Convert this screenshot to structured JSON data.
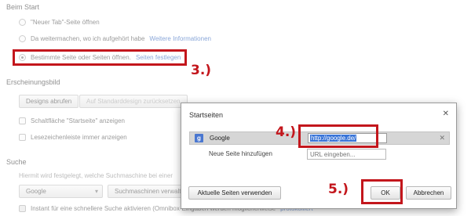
{
  "settings": {
    "startup": {
      "title": "Beim Start",
      "options": [
        {
          "label": "\"Neuer Tab\"-Seite öffnen",
          "link": ""
        },
        {
          "label": "Da weitermachen, wo ich aufgehört habe",
          "link": "Weitere Informationen"
        },
        {
          "label": "Bestimmte Seite oder Seiten öffnen.",
          "link": "Seiten festlegen"
        }
      ],
      "selected_index": 2
    },
    "appearance": {
      "title": "Erscheinungsbild",
      "get_themes_button": "Designs abrufen",
      "reset_theme_button": "Auf Standarddesign zurücksetzen",
      "show_home_checkbox": "Schaltfläche \"Startseite\" anzeigen",
      "show_bookmarks_checkbox": "Lesezeichenleiste immer anzeigen"
    },
    "search": {
      "title": "Suche",
      "description": "Hiermit wird festgelegt, welche Suchmaschine bei einer",
      "engine_select": "Google",
      "manage_button": "Suchmaschinen verwalt",
      "instant_label": "Instant für eine schnellere Suche aktivieren (Omnibox-Eingaben werden möglicherweise",
      "instant_link": "protokolliert"
    }
  },
  "annotations": {
    "step3": "3.)",
    "step4": "4.)",
    "step5": "5.)",
    "color": "#c3161c"
  },
  "dialog": {
    "title": "Startseiten",
    "close_icon": "close-icon",
    "pages": [
      {
        "name": "Google",
        "url": "http://google.de/",
        "favicon": "g"
      }
    ],
    "new_page_label": "Neue Seite hinzufügen",
    "url_placeholder": "URL eingeben...",
    "use_current_button": "Aktuelle Seiten verwenden",
    "ok_button": "OK",
    "cancel_button": "Abbrechen"
  }
}
